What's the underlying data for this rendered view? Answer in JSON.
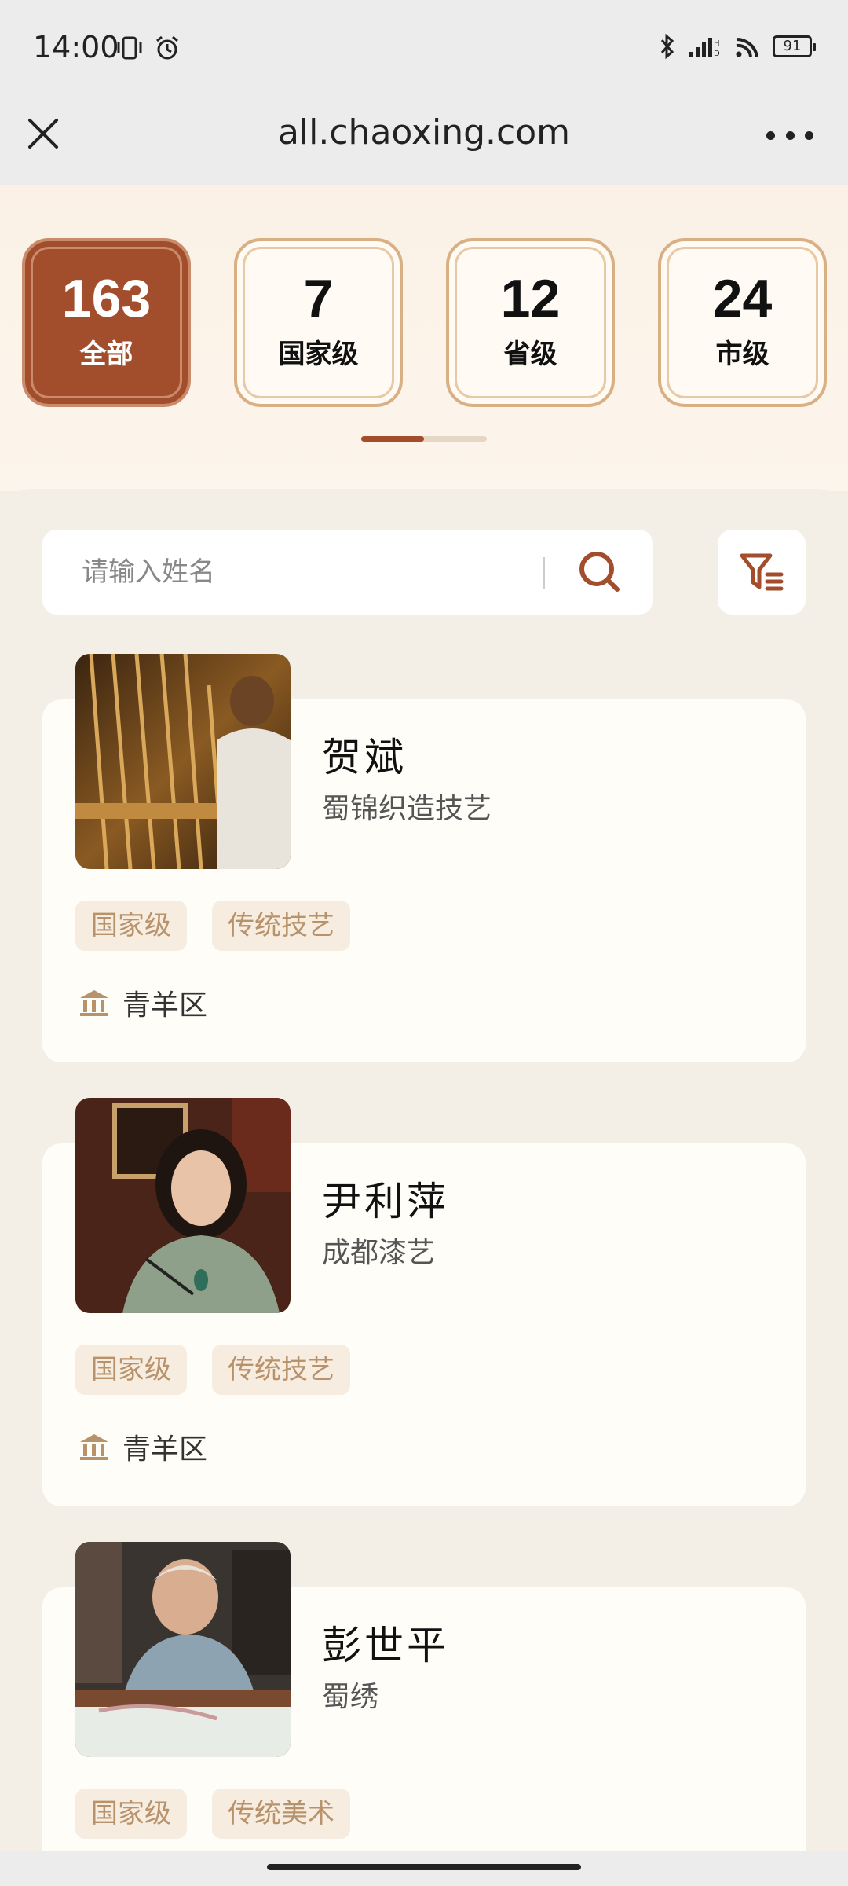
{
  "status": {
    "time": "14:00",
    "battery": "91"
  },
  "browser": {
    "url": "all.chaoxing.com"
  },
  "stats": [
    {
      "value": "163",
      "label": "全部",
      "active": true
    },
    {
      "value": "7",
      "label": "国家级",
      "active": false
    },
    {
      "value": "12",
      "label": "省级",
      "active": false
    },
    {
      "value": "24",
      "label": "市级",
      "active": false
    }
  ],
  "search": {
    "placeholder": "请输入姓名"
  },
  "cards": [
    {
      "name": "贺斌",
      "craft": "蜀锦织造技艺",
      "tags": [
        "国家级",
        "传统技艺"
      ],
      "location": "青羊区"
    },
    {
      "name": "尹利萍",
      "craft": "成都漆艺",
      "tags": [
        "国家级",
        "传统技艺"
      ],
      "location": "青羊区"
    },
    {
      "name": "彭世平",
      "craft": "蜀绣",
      "tags": [
        "国家级",
        "传统美术"
      ],
      "location": ""
    }
  ],
  "colors": {
    "accent": "#a24e2d",
    "card_border": "#d8b083",
    "tag_bg": "#f6ede0",
    "tag_text": "#b8926a"
  },
  "icons": [
    "close-icon",
    "more-icon",
    "search-icon",
    "filter-icon",
    "museum-icon"
  ]
}
